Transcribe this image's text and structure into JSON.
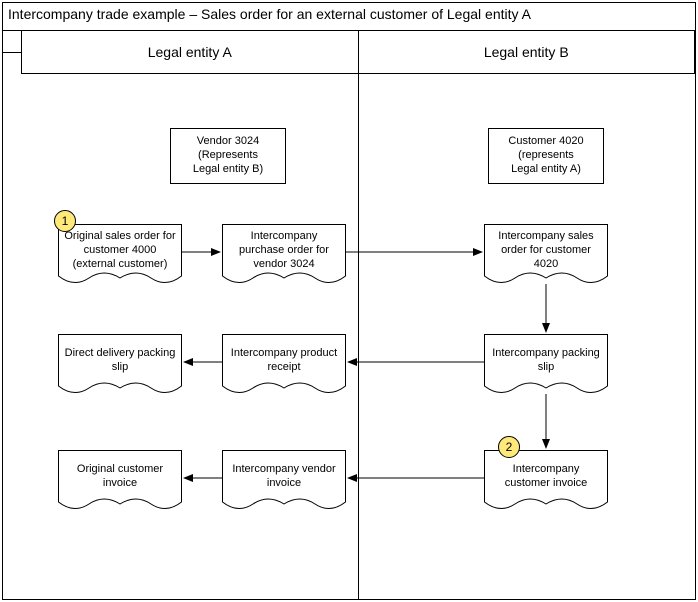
{
  "title": "Intercompany trade example – Sales order for an external customer of Legal entity A",
  "columns": {
    "a": "Legal entity A",
    "b": "Legal entity B"
  },
  "boxes": {
    "vendor": "Vendor 3024\n(Represents\nLegal entity B)",
    "customer": "Customer 4020\n(represents\nLegal entity A)"
  },
  "docs": {
    "origSO": "Original sales order for customer 4000 (external customer)",
    "icPO": "Intercompany purchase order for vendor 3024",
    "icSO": "Intercompany sales order for customer 4020",
    "ddSlip": "Direct delivery packing slip",
    "icReceipt": "Intercompany product receipt",
    "icSlip": "Intercompany packing slip",
    "origInv": "Original customer invoice",
    "icVendInv": "Intercompany vendor invoice",
    "icCustInv": "Intercompany customer invoice"
  },
  "badges": {
    "b1": "1",
    "b2": "2"
  }
}
